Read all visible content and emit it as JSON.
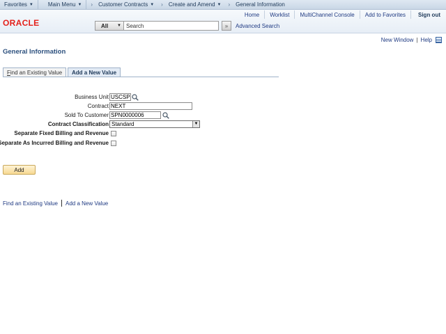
{
  "nav": {
    "favorites": "Favorites",
    "main_menu": "Main Menu",
    "customer_contracts": "Customer Contracts",
    "create_and_amend": "Create and Amend",
    "general_information": "General Information"
  },
  "header": {
    "logo": "ORACLE",
    "links": {
      "home": "Home",
      "worklist": "Worklist",
      "multichannel_console": "MultiChannel Console",
      "add_to_favorites": "Add to Favorites",
      "sign_out": "Sign out"
    },
    "search": {
      "scope": "All",
      "value": "Search",
      "go": "»",
      "advanced_search": "Advanced Search"
    }
  },
  "pagebar": {
    "new_window": "New Window",
    "help": "Help",
    "icon": "grid-icon"
  },
  "page_title": "General Information",
  "tabs": [
    {
      "label_first": "F",
      "label_rest": "ind an Existing Value",
      "active": false
    },
    {
      "label": "Add a New Value",
      "active": true
    }
  ],
  "form": {
    "business_unit": {
      "label": "Business Unit",
      "value": "USCSP"
    },
    "contract": {
      "label": "Contract",
      "value": "NEXT"
    },
    "sold_to_customer": {
      "label": "Sold To Customer",
      "value": "SPN0000006"
    },
    "contract_classification": {
      "label": "Contract Classification",
      "value": "Standard"
    },
    "separate_fixed": {
      "label": "Separate Fixed Billing and Revenue",
      "checked": false
    },
    "separate_as_incurred": {
      "label": "Separate As Incurred Billing and Revenue",
      "checked": false
    }
  },
  "add_button": "Add",
  "bottom_links": {
    "find_existing": "Find an Existing Value",
    "add_new": "Add a New Value"
  }
}
